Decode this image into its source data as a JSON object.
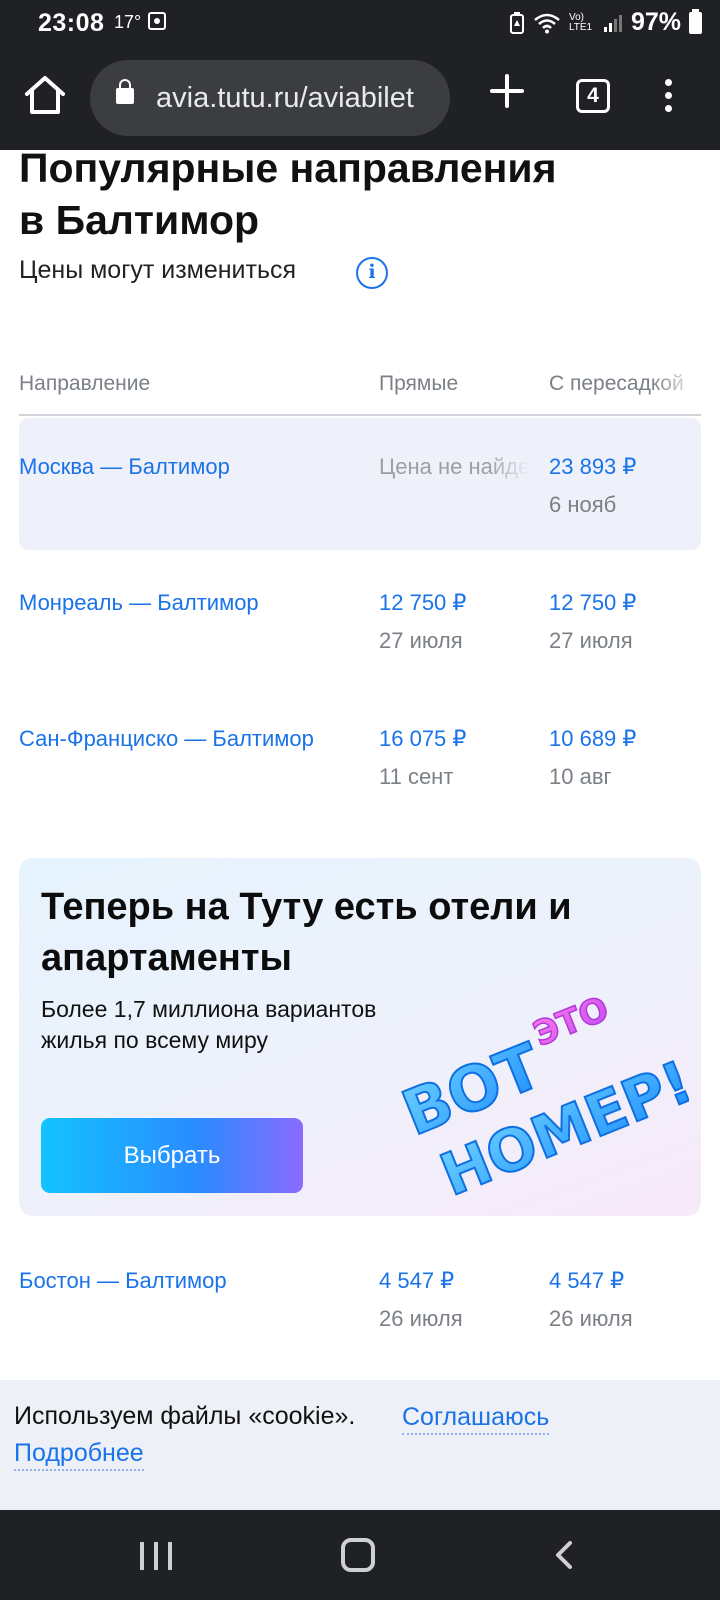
{
  "status_bar": {
    "time": "23:08",
    "small_indicator": "17°",
    "network_label": "Vo) LTE1",
    "battery_percent": "97%"
  },
  "browser": {
    "url": "avia.tutu.ru/aviabilet",
    "tab_count": "4"
  },
  "page": {
    "title_line1": "Популярные направления",
    "title_line2": "в Балтимор",
    "subtitle": "Цены могут измениться",
    "columns": [
      "Направление",
      "Прямые",
      "С пересадкой"
    ],
    "rows": [
      {
        "destination": "Москва — Балтимор",
        "direct_price": "",
        "direct_date": "",
        "direct_note": "Цена не найдена",
        "transfer_price": "23 893 ₽",
        "transfer_date": "6 нояб"
      },
      {
        "destination": "Монреаль — Балтимор",
        "direct_price": "12 750 ₽",
        "direct_date": "27 июля",
        "transfer_price": "12 750 ₽",
        "transfer_date": "27 июля"
      },
      {
        "destination": "Сан-Франциско — Балтимор",
        "direct_price": "16 075 ₽",
        "direct_date": "11 сент",
        "transfer_price": "10 689 ₽",
        "transfer_date": "10 авг"
      },
      {
        "destination": "Бостон — Балтимор",
        "direct_price": "4 547 ₽",
        "direct_date": "26 июля",
        "transfer_price": "4 547 ₽",
        "transfer_date": "26 июля"
      }
    ]
  },
  "promo": {
    "title": "Теперь на Туту есть отели и апартаменты",
    "text": "Более 1,7 миллиона вариантов жилья по всему миру",
    "button": "Выбрать",
    "art_words": [
      "ВОТ",
      "ЭТО",
      "НОМЕР!"
    ]
  },
  "cookie": {
    "text": "Используем файлы «cookie».",
    "agree": "Соглашаюсь",
    "more": "Подробнее"
  },
  "colors": {
    "link": "#1a73e8",
    "muted": "#7b8087",
    "highlight_row": "#eef1fa",
    "system_bars": "#202124"
  },
  "icons": {
    "home": "home-icon",
    "lock": "lock-icon",
    "new_tab": "plus-icon",
    "menu": "kebab-menu-icon",
    "info": "info-icon"
  }
}
